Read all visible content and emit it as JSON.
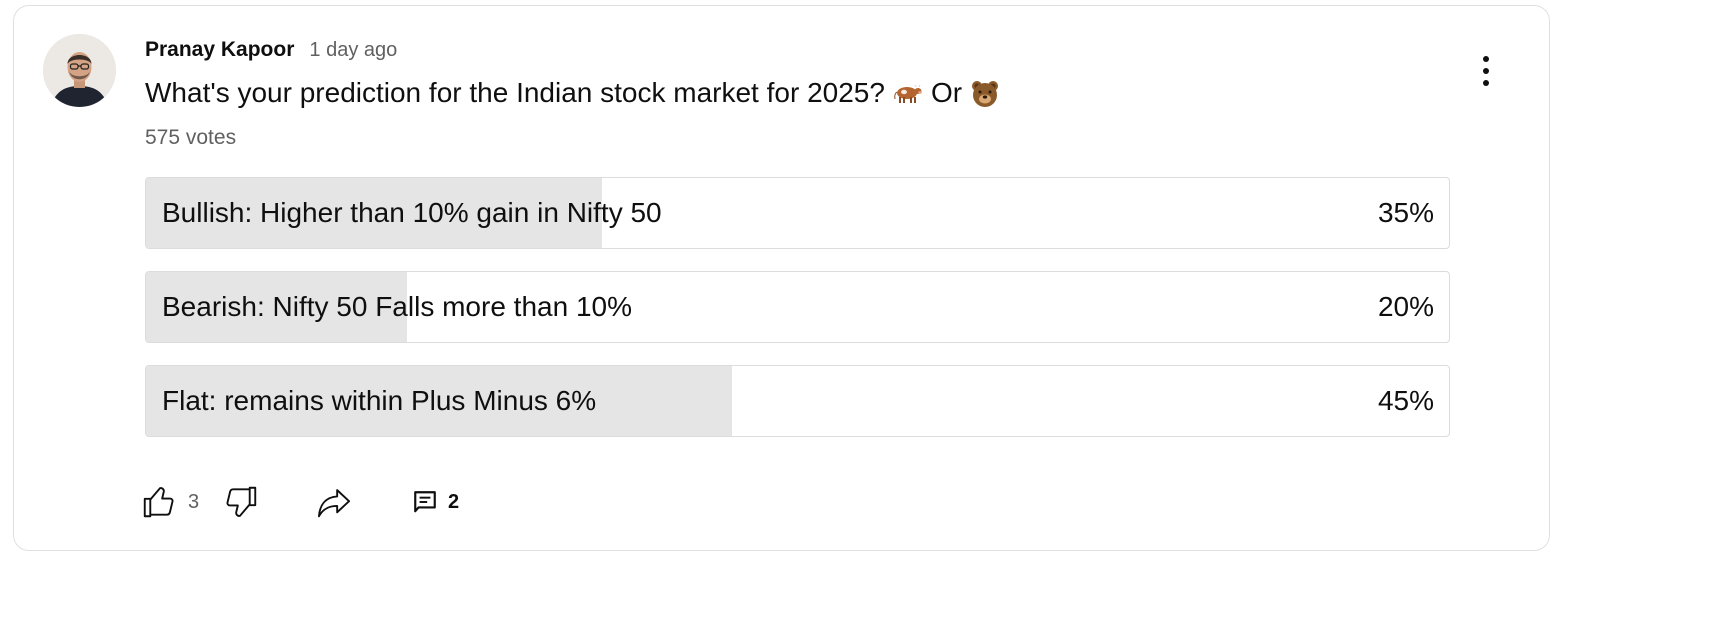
{
  "post": {
    "author": "Pranay Kapoor",
    "time": "1 day ago",
    "question_text": "What's your prediction for the Indian stock market for 2025?",
    "question_or": "Or",
    "emoji_1": "cow-emoji",
    "emoji_2": "bear-emoji",
    "votes": "575 votes",
    "menu_icon": "more-vert-icon"
  },
  "poll": {
    "options": [
      {
        "label": "Bullish: Higher than 10% gain in Nifty 50",
        "percent": "35%",
        "fill_fraction": 0.35
      },
      {
        "label": "Bearish: Nifty 50 Falls more than 10%",
        "percent": "20%",
        "fill_fraction": 0.2
      },
      {
        "label": "Flat: remains within Plus Minus 6%",
        "percent": "45%",
        "fill_fraction": 0.45
      }
    ],
    "fill_color": "#e5e5e5"
  },
  "actions": {
    "like_icon": "thumbs-up-icon",
    "like_count": "3",
    "dislike_icon": "thumbs-down-icon",
    "share_icon": "share-icon",
    "comment_icon": "comment-icon",
    "comment_count": "2"
  }
}
